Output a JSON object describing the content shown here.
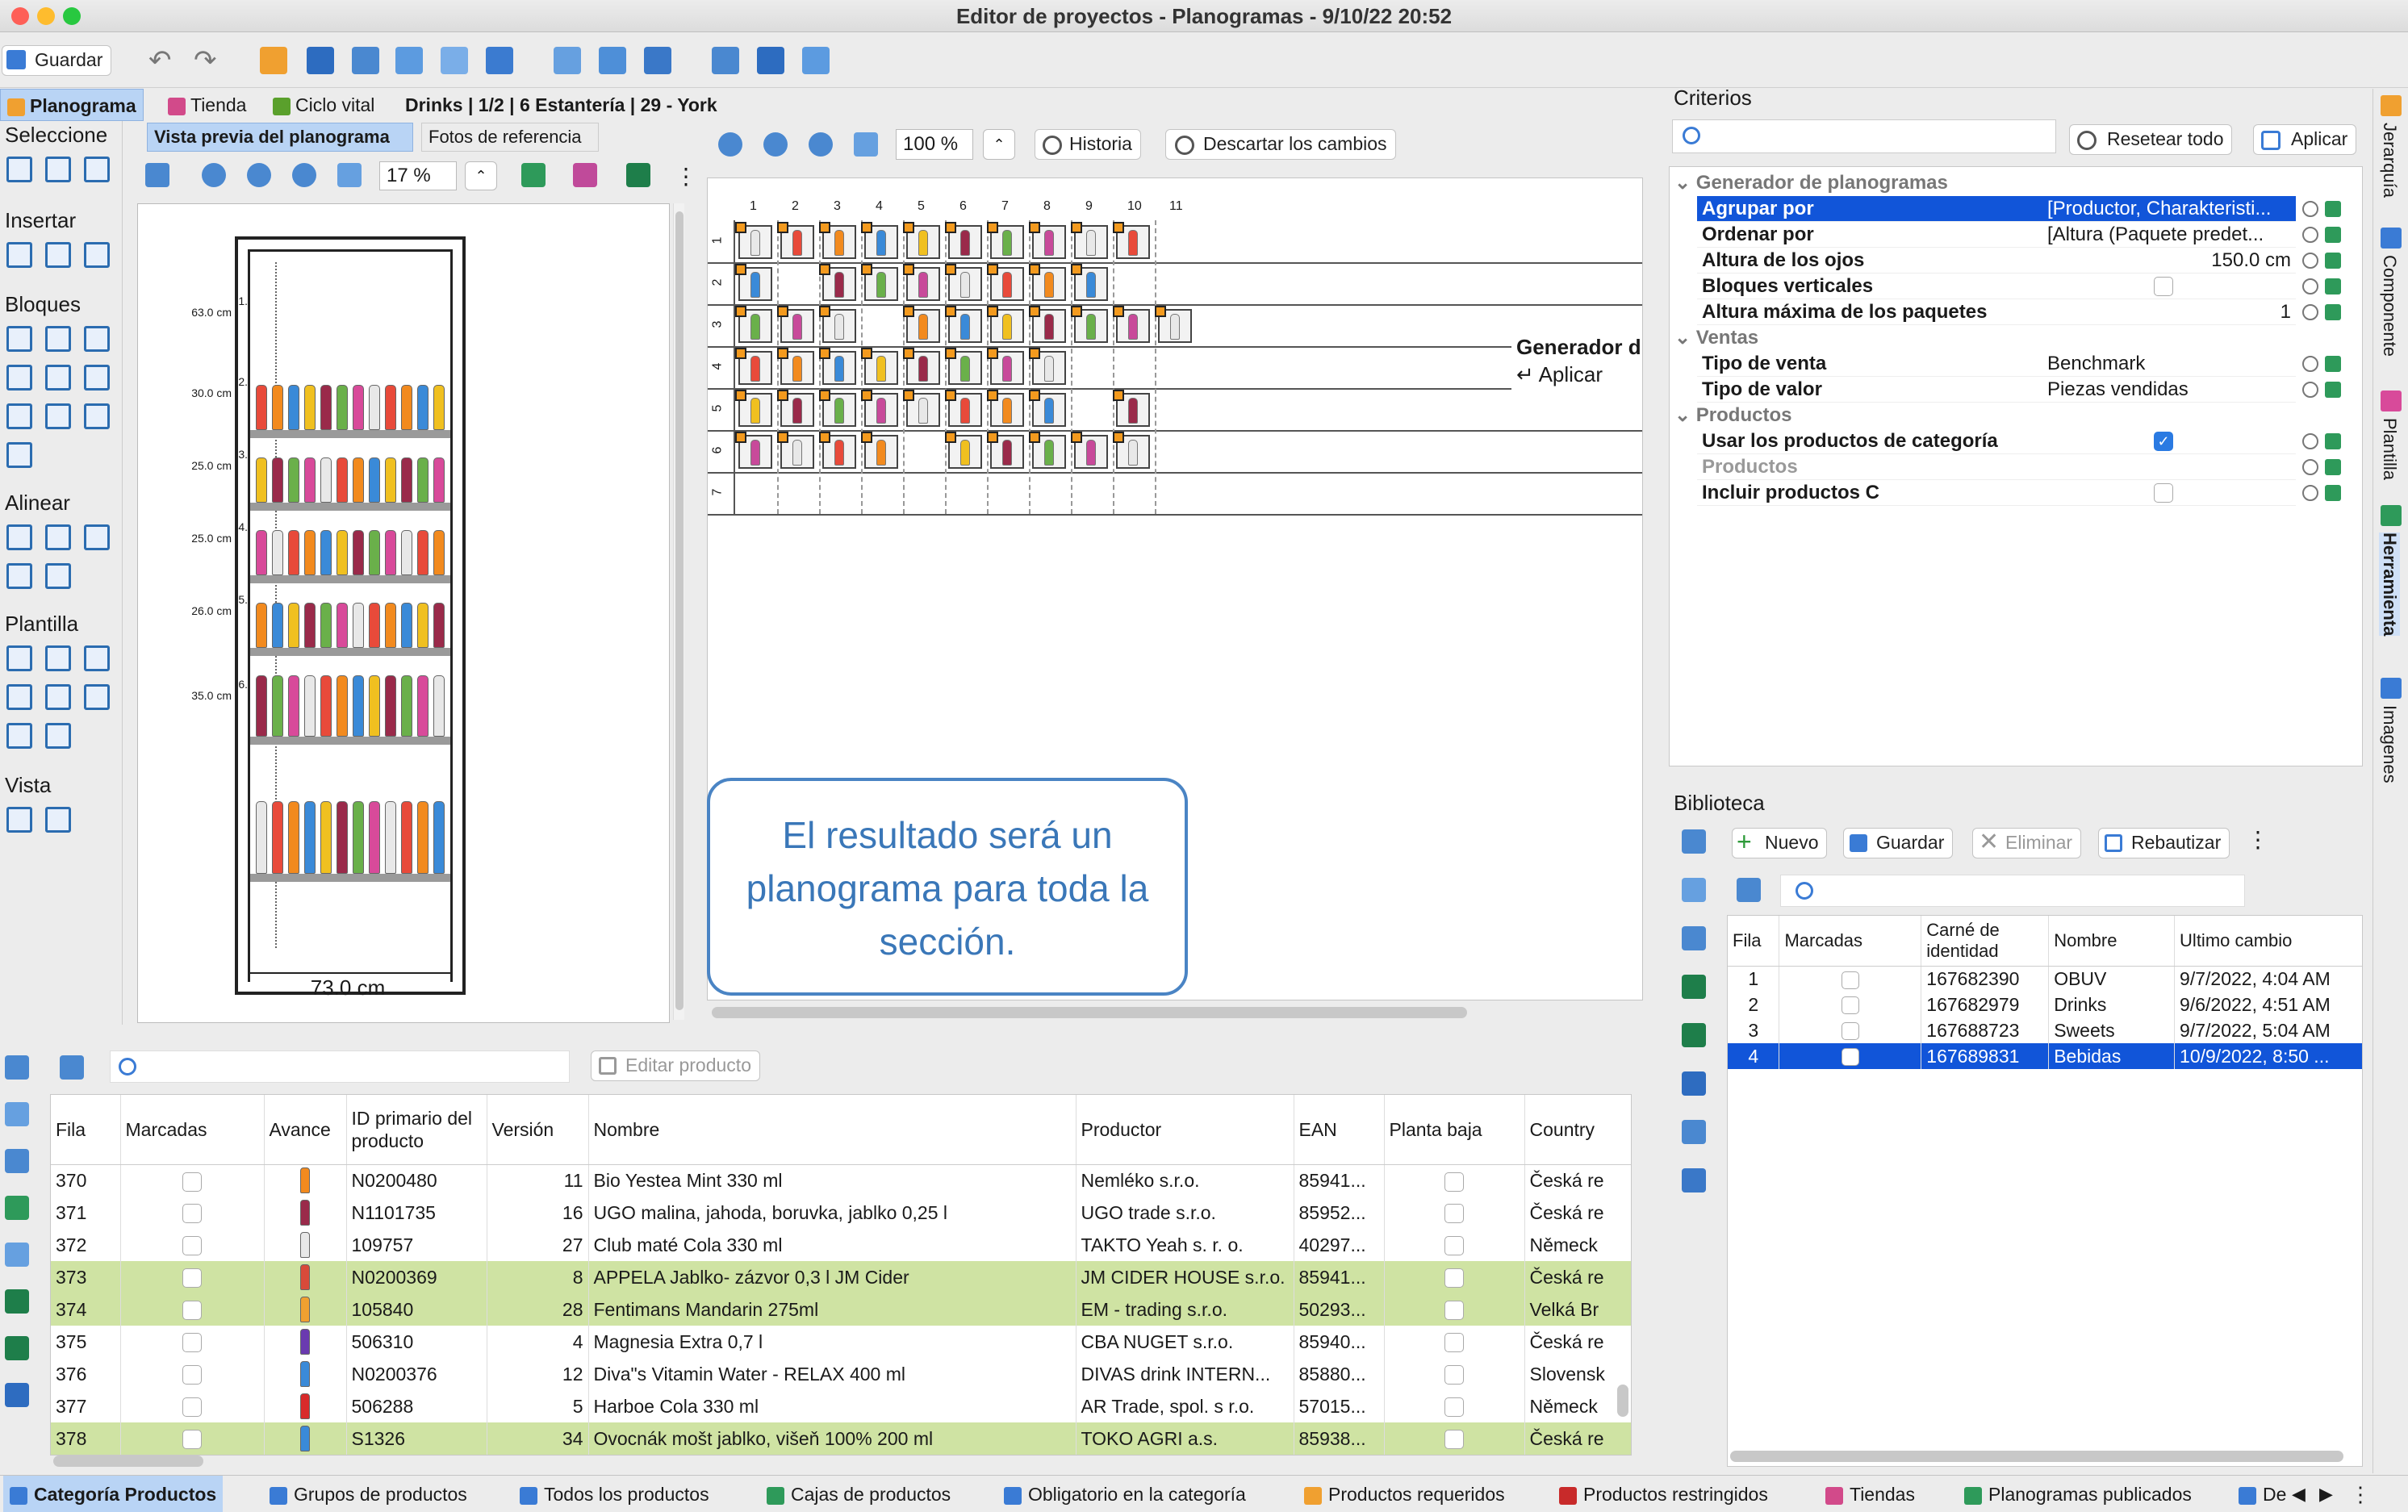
{
  "window": {
    "title": "Editor de proyectos - Planogramas - 9/10/22 20:52"
  },
  "toolbar": {
    "save_label": "Guardar"
  },
  "view_tabs": {
    "planograma": "Planograma",
    "tienda": "Tienda",
    "ciclo": "Ciclo vital",
    "breadcrumb": "Drinks | 1/2 | 6 Estantería | 29 - York"
  },
  "left_palette": {
    "seleccione": "Seleccione",
    "insertar": "Insertar",
    "bloques": "Bloques",
    "alinear": "Alinear",
    "plantilla": "Plantilla",
    "vista": "Vista"
  },
  "preview": {
    "tab_active": "Vista previa del planograma",
    "tab_other": "Fotos de referencia",
    "zoom": "17 %",
    "width_label": "73.0 cm",
    "shelves": [
      {
        "n": "1.",
        "h": "63.0 cm"
      },
      {
        "n": "2.",
        "h": "30.0 cm"
      },
      {
        "n": "3.",
        "h": "25.0 cm"
      },
      {
        "n": "4.",
        "h": "25.0 cm"
      },
      {
        "n": "5.",
        "h": "26.0 cm"
      },
      {
        "n": "6.",
        "h": "35.0 cm"
      }
    ]
  },
  "editor": {
    "zoom": "100 %",
    "history": "Historia",
    "discard": "Descartar los cambios",
    "col_numbers": [
      "1",
      "2",
      "3",
      "4",
      "5",
      "6",
      "7",
      "8",
      "9",
      "10",
      "11"
    ],
    "row_numbers": [
      "1",
      "2",
      "3",
      "4",
      "5",
      "6",
      "7"
    ],
    "generator_label": "Generador d",
    "apply_label": "↵ Aplicar",
    "callout": "El resultado será un planograma para toda la sección."
  },
  "criteria": {
    "title": "Criterios",
    "reset": "Resetear todo",
    "apply": "Aplicar",
    "sections": [
      {
        "title": "Generador de planogramas",
        "rows": [
          {
            "k": "Agrupar por",
            "v": "[Productor, Charakteristi..."
          },
          {
            "k": "Ordenar por",
            "v": "[Altura (Paquete predet..."
          },
          {
            "k": "Altura de los ojos",
            "v": "150.0 cm"
          },
          {
            "k": "Bloques verticales",
            "v": ""
          },
          {
            "k": "Altura máxima de los paquetes",
            "v": "1"
          }
        ]
      },
      {
        "title": "Ventas",
        "rows": [
          {
            "k": "Tipo de venta",
            "v": "Benchmark"
          },
          {
            "k": "Tipo de valor",
            "v": "Piezas vendidas"
          }
        ]
      },
      {
        "title": "Productos",
        "rows": [
          {
            "k": "Usar los productos de categoría",
            "v": ""
          },
          {
            "k": "Productos",
            "v": ""
          },
          {
            "k": "Incluir productos C",
            "v": ""
          }
        ]
      }
    ]
  },
  "right_tabs": [
    "Jerarquía",
    "Componente",
    "Plantilla",
    "Herramienta",
    "Imagenes"
  ],
  "library": {
    "title": "Biblioteca",
    "new": "Nuevo",
    "save": "Guardar",
    "delete": "Eliminar",
    "rebuild": "Rebautizar",
    "headers": [
      "Fila",
      "Marcadas",
      "Carné de identidad",
      "Nombre",
      "Ultimo cambio"
    ],
    "rows": [
      {
        "fila": "1",
        "id": "167682390",
        "name": "OBUV",
        "date": "9/7/2022, 4:04 AM"
      },
      {
        "fila": "2",
        "id": "167682979",
        "name": "Drinks",
        "date": "9/6/2022, 4:51 AM"
      },
      {
        "fila": "3",
        "id": "167688723",
        "name": "Sweets",
        "date": "9/7/2022, 5:04 AM"
      },
      {
        "fila": "4",
        "id": "167689831",
        "name": "Bebidas",
        "date": "10/9/2022, 8:50 ..."
      }
    ]
  },
  "products": {
    "edit_label": "Editar producto",
    "headers": [
      "Fila",
      "Marcadas",
      "Avance",
      "ID primario del producto",
      "Versión",
      "Nombre",
      "Productor",
      "EAN",
      "Planta baja",
      "Country"
    ],
    "rows": [
      {
        "fila": "370",
        "id": "N0200480",
        "ver": "11",
        "name": "Bio Yestea Mint 330 ml",
        "prod": "Nemléko s.r.o.",
        "ean": "85941...",
        "country": "Česká re"
      },
      {
        "fila": "371",
        "id": "N1101735",
        "ver": "16",
        "name": "UGO malina, jahoda, boruvka, jablko 0,25 l",
        "prod": "UGO trade s.r.o.",
        "ean": "85952...",
        "country": "Česká re"
      },
      {
        "fila": "372",
        "id": "109757",
        "ver": "27",
        "name": "Club maté Cola 330 ml",
        "prod": "TAKTO Yeah s. r. o.",
        "ean": "40297...",
        "country": "Německ"
      },
      {
        "fila": "373",
        "id": "N0200369",
        "ver": "8",
        "name": "APPELA Jablko- zázvor 0,3 l JM Cider",
        "prod": "JM CIDER HOUSE s.r.o.",
        "ean": "85941...",
        "country": "Česká re"
      },
      {
        "fila": "374",
        "id": "105840",
        "ver": "28",
        "name": "Fentimans Mandarin 275ml",
        "prod": "EM - trading s.r.o.",
        "ean": "50293...",
        "country": "Velká Br"
      },
      {
        "fila": "375",
        "id": "506310",
        "ver": "4",
        "name": "Magnesia Extra 0,7 l",
        "prod": "CBA NUGET s.r.o.",
        "ean": "85940...",
        "country": "Česká re"
      },
      {
        "fila": "376",
        "id": "N0200376",
        "ver": "12",
        "name": "Diva\"s Vitamin Water - RELAX 400 ml",
        "prod": "DIVAS drink INTERN...",
        "ean": "85880...",
        "country": "Slovensk"
      },
      {
        "fila": "377",
        "id": "506288",
        "ver": "5",
        "name": "Harboe Cola 330 ml",
        "prod": "AR Trade, spol. s r.o.",
        "ean": "57015...",
        "country": "Německ"
      },
      {
        "fila": "378",
        "id": "S1326",
        "ver": "34",
        "name": "Ovocnák mošt jablko, višeň 100% 200 ml",
        "prod": "TOKO AGRI a.s.",
        "ean": "85938...",
        "country": "Česká re"
      }
    ]
  },
  "bottom_tabs": [
    "Categoría Productos",
    "Grupos de productos",
    "Todos los productos",
    "Cajas de productos",
    "Obligatorio en la categoría",
    "Productos requeridos",
    "Productos restringidos",
    "Tiendas",
    "Planogramas publicados",
    "De"
  ]
}
